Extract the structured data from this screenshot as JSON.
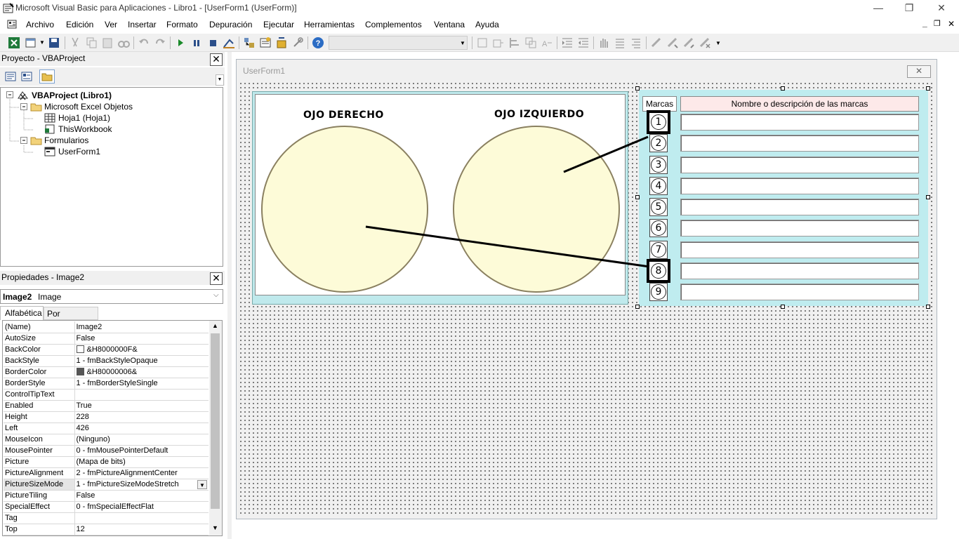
{
  "window": {
    "title": "Microsoft Visual Basic para Aplicaciones - Libro1 - [UserForm1 (UserForm)]",
    "minimize_glyph": "—",
    "restore_glyph": "❐",
    "close_glyph": "✕"
  },
  "menu": {
    "items": [
      {
        "label": "Archivo"
      },
      {
        "label": "Edición"
      },
      {
        "label": "Ver"
      },
      {
        "label": "Insertar"
      },
      {
        "label": "Formato"
      },
      {
        "label": "Depuración"
      },
      {
        "label": "Ejecutar"
      },
      {
        "label": "Herramientas"
      },
      {
        "label": "Complementos"
      },
      {
        "label": "Ventana"
      },
      {
        "label": "Ayuda"
      }
    ],
    "child_min": "_",
    "child_restore": "❐",
    "child_close": "✕"
  },
  "project": {
    "header": "Proyecto - VBAProject",
    "close": "✕",
    "root": "VBAProject (Libro1)",
    "folder_excel": "Microsoft Excel Objetos",
    "sheet1": "Hoja1 (Hoja1)",
    "workbook": "ThisWorkbook",
    "folder_forms": "Formularios",
    "userform": "UserForm1"
  },
  "properties": {
    "header": "Propiedades - Image2",
    "close": "✕",
    "object_name": "Image2",
    "object_type": "Image",
    "tab_alpha": "Alfabética",
    "tab_cat": "Por categorías",
    "rows": [
      {
        "name": "(Name)",
        "value": "Image2"
      },
      {
        "name": "AutoSize",
        "value": "False"
      },
      {
        "name": "BackColor",
        "value": "&H8000000F&",
        "swatch": "#ffffff"
      },
      {
        "name": "BackStyle",
        "value": "1 - fmBackStyleOpaque"
      },
      {
        "name": "BorderColor",
        "value": "&H80000006&",
        "swatch": "#555555"
      },
      {
        "name": "BorderStyle",
        "value": "1 - fmBorderStyleSingle"
      },
      {
        "name": "ControlTipText",
        "value": ""
      },
      {
        "name": "Enabled",
        "value": "True"
      },
      {
        "name": "Height",
        "value": "228"
      },
      {
        "name": "Left",
        "value": "426"
      },
      {
        "name": "MouseIcon",
        "value": "(Ninguno)"
      },
      {
        "name": "MousePointer",
        "value": "0 - fmMousePointerDefault"
      },
      {
        "name": "Picture",
        "value": "(Mapa de bits)"
      },
      {
        "name": "PictureAlignment",
        "value": "2 - fmPictureAlignmentCenter"
      },
      {
        "name": "PictureSizeMode",
        "value": "1 - fmPictureSizeModeStretch",
        "selected": true
      },
      {
        "name": "PictureTiling",
        "value": "False"
      },
      {
        "name": "SpecialEffect",
        "value": "0 - fmSpecialEffectFlat"
      },
      {
        "name": "Tag",
        "value": ""
      },
      {
        "name": "Top",
        "value": "12"
      }
    ]
  },
  "userform": {
    "caption": "UserForm1",
    "close_glyph": "✕",
    "right_eye_label": "OJO DERECHO",
    "left_eye_label": "OJO IZQUIERDO",
    "marks_header": "Marcas",
    "desc_header": "Nombre o descripción de las marcas",
    "marks": [
      "1",
      "2",
      "3",
      "4",
      "5",
      "6",
      "7",
      "8",
      "9"
    ],
    "selected_marks": [
      "1",
      "8"
    ]
  },
  "colors": {
    "eye_fill": "#fdfbd8",
    "eye_stroke": "#8a8060",
    "frame_bg": "#bfecef",
    "header_bg": "#fde9e9"
  }
}
